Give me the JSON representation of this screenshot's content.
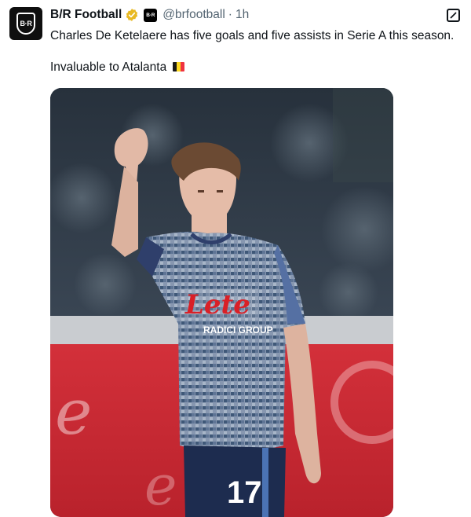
{
  "tweet": {
    "author_name": "B/R Football",
    "handle": "@brfootball",
    "separator": "·",
    "time": "1h",
    "avatar_text": "B·R",
    "affiliate_badge_text": "B·R",
    "text_line1": "Charles De Ketelaere has five goals and five assists in Serie A this season.",
    "text_line2": "Invaluable to Atalanta",
    "flag_emoji_colors": [
      "#000000",
      "#fdda24",
      "#ef3340"
    ]
  },
  "media": {
    "shirt_sponsor": "Lete",
    "shirt_sub_sponsor": "RADICI GROUP",
    "shirt_number": "17"
  },
  "colors": {
    "verified_gold": "#e8b923",
    "handle_gray": "#536471"
  }
}
